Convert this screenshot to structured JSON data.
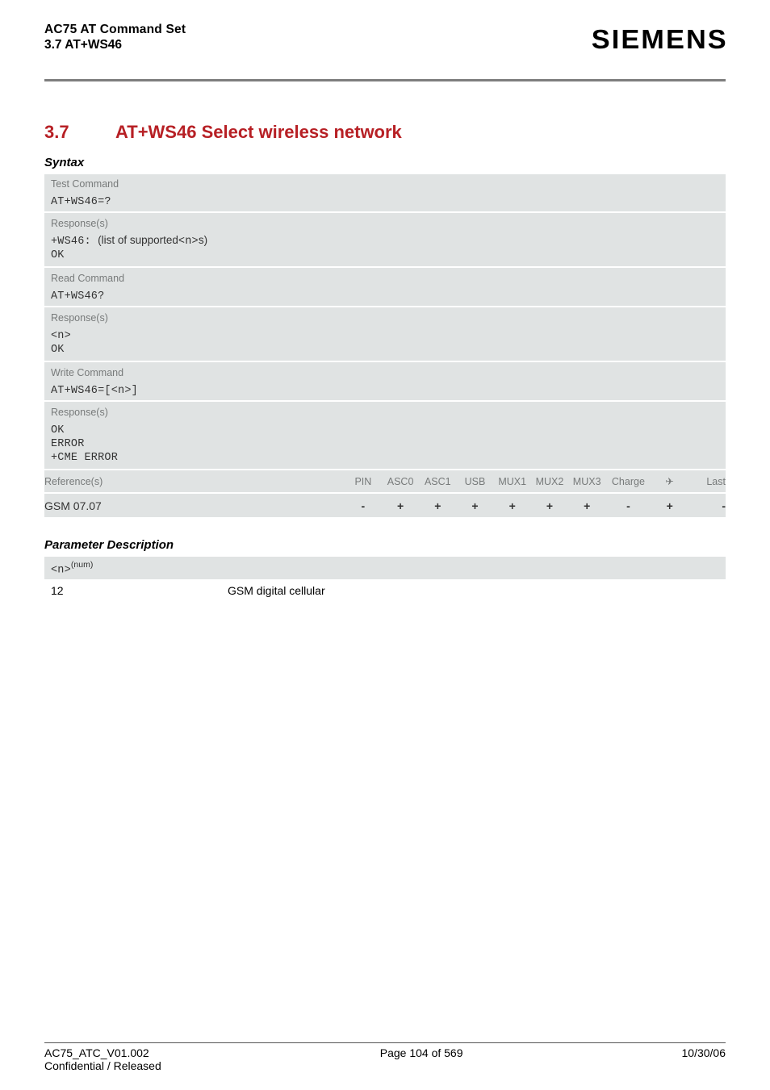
{
  "header": {
    "doc_title": "AC75 AT Command Set",
    "doc_section": "3.7 AT+WS46",
    "brand": "SIEMENS"
  },
  "section": {
    "number": "3.7",
    "title": "AT+WS46   Select wireless network"
  },
  "syntax_label": "Syntax",
  "panel": {
    "test": {
      "label": "Test Command",
      "cmd": "AT+WS46=?",
      "resp_label": "Response(s)",
      "resp_prefix": "+WS46: ",
      "resp_text1": "(list of supported",
      "resp_link": "<n>",
      "resp_text2": "s)",
      "resp_ok": "OK"
    },
    "read": {
      "label": "Read Command",
      "cmd": "AT+WS46?",
      "resp_label": "Response(s)",
      "resp_link": "<n>",
      "resp_ok": "OK"
    },
    "write": {
      "label": "Write Command",
      "cmd_prefix": "AT+WS46=",
      "cmd_lb": "[",
      "cmd_link": "<n>",
      "cmd_rb": "]",
      "resp_label": "Response(s)",
      "resp_ok": "OK",
      "resp_error": "ERROR",
      "resp_cme": "+CME ERROR"
    },
    "ref": {
      "label": "Reference(s)",
      "value": "GSM 07.07",
      "cols": [
        "PIN",
        "ASC0",
        "ASC1",
        "USB",
        "MUX1",
        "MUX2",
        "MUX3",
        "Charge",
        "✈",
        "Last"
      ],
      "vals": [
        "-",
        "+",
        "+",
        "+",
        "+",
        "+",
        "+",
        "-",
        "+",
        "-"
      ]
    }
  },
  "param_desc_label": "Parameter Description",
  "param": {
    "name": "<n>",
    "sup": "(num)",
    "value": "12",
    "desc": "GSM digital cellular"
  },
  "footer": {
    "left1": "AC75_ATC_V01.002",
    "left2": "Confidential / Released",
    "center": "Page 104 of 569",
    "right": "10/30/06"
  }
}
